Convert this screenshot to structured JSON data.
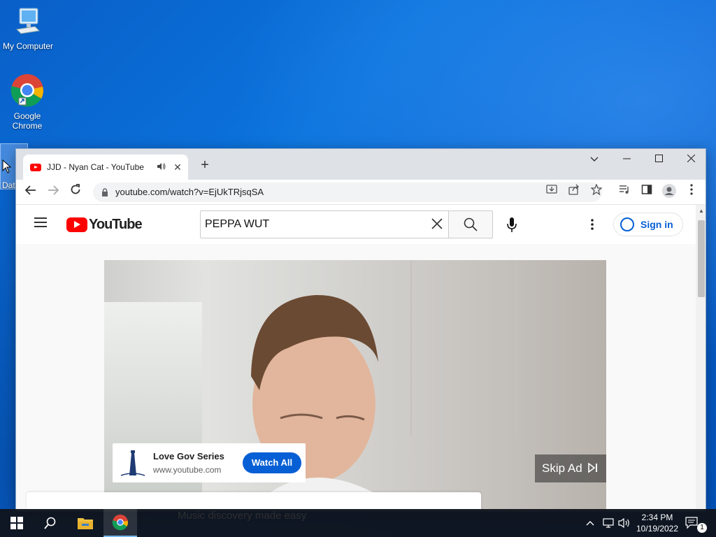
{
  "desktop": {
    "icons": [
      {
        "label": "My Computer"
      },
      {
        "label": "Google\nChrome"
      },
      {
        "label": "Dat"
      }
    ]
  },
  "browser": {
    "tab": {
      "title": "JJD - Nyan Cat - YouTube"
    },
    "omnibox": {
      "url": "youtube.com/watch?v=EjUkTRjsqSA"
    }
  },
  "youtube": {
    "logo_text": "YouTube",
    "search": {
      "value": "PEPPA WUT"
    },
    "signin_label": "Sign in",
    "ad": {
      "title": "Love Gov Series",
      "url": "www.youtube.com",
      "cta": "Watch All",
      "skip_label": "Skip Ad"
    },
    "bottom_card_text": "Music discovery made easy"
  },
  "taskbar": {
    "time": "2:34 PM",
    "date": "10/19/2022",
    "notification_count": "1"
  },
  "colors": {
    "desktop_blue": "#0a64d4",
    "youtube_red": "#ff0000",
    "link_blue": "#065fd4",
    "taskbar": "#10141c"
  }
}
